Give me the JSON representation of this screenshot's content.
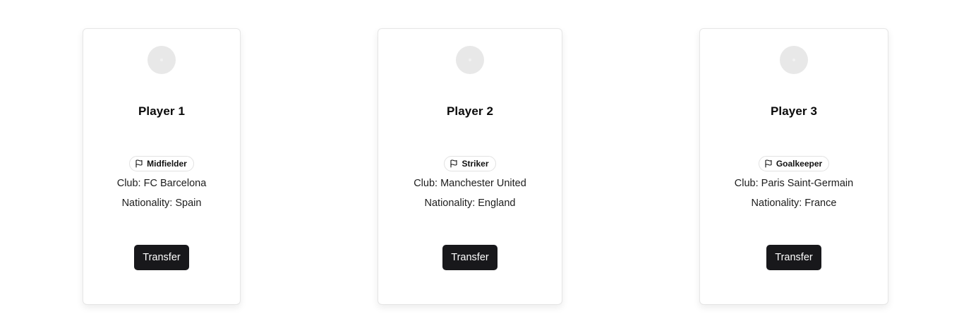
{
  "players": [
    {
      "name": "Player 1",
      "position": "Midfielder",
      "club": "Club: FC Barcelona",
      "nationality": "Nationality: Spain",
      "action_label": "Transfer"
    },
    {
      "name": "Player 2",
      "position": "Striker",
      "club": "Club: Manchester United",
      "nationality": "Nationality: England",
      "action_label": "Transfer"
    },
    {
      "name": "Player 3",
      "position": "Goalkeeper",
      "club": "Club: Paris Saint-Germain",
      "nationality": "Nationality: France",
      "action_label": "Transfer"
    }
  ],
  "icons": {
    "avatar": "avatar-placeholder",
    "badge": "flag-icon"
  },
  "colors": {
    "button_bg": "#18181b",
    "button_text": "#ffffff",
    "avatar_bg": "#e8e8e8",
    "card_border": "#e6e6e6"
  }
}
